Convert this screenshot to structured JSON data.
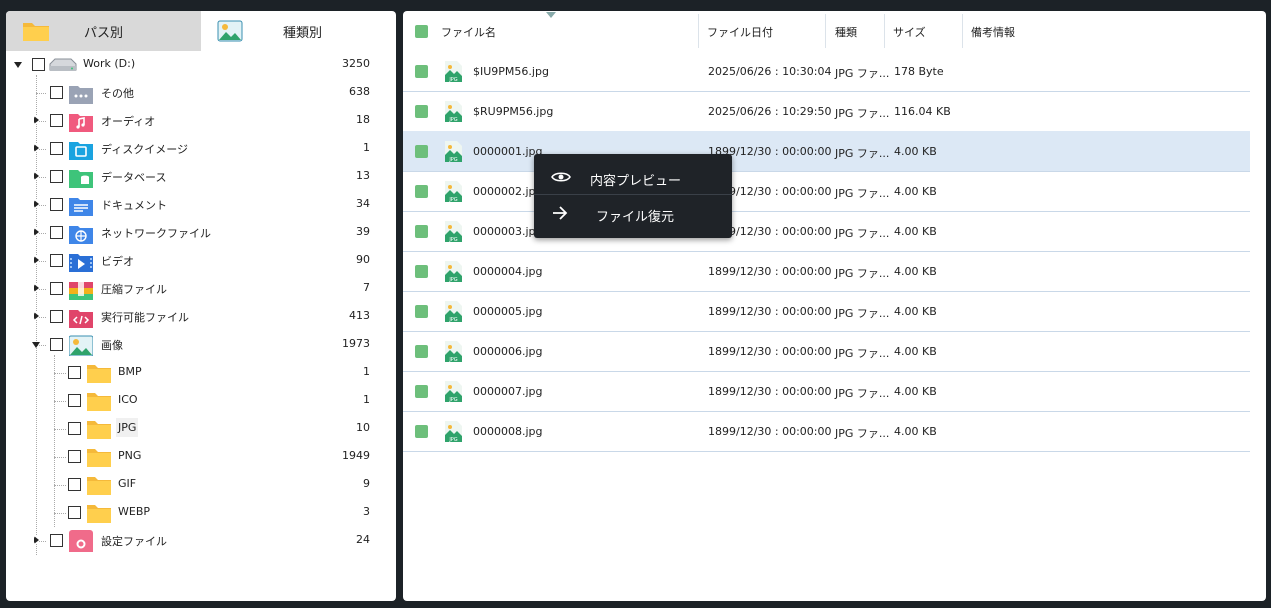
{
  "tabs": {
    "path_label": "パス別",
    "type_label": "種類別"
  },
  "tree": {
    "root": {
      "label": "Work (D:)",
      "count": "3250"
    },
    "items": [
      {
        "label": "その他",
        "count": "638",
        "icon": "other-icon",
        "color": "#9aa3b5"
      },
      {
        "label": "オーディオ",
        "count": "18",
        "icon": "audio-icon",
        "color": "#f05a7e"
      },
      {
        "label": "ディスクイメージ",
        "count": "1",
        "icon": "disk-image-icon",
        "color": "#1aa3e0"
      },
      {
        "label": "データベース",
        "count": "13",
        "icon": "database-icon",
        "color": "#3ec47a"
      },
      {
        "label": "ドキュメント",
        "count": "34",
        "icon": "document-icon",
        "color": "#3f86e8"
      },
      {
        "label": "ネットワークファイル",
        "count": "39",
        "icon": "network-icon",
        "color": "#3f86e8"
      },
      {
        "label": "ビデオ",
        "count": "90",
        "icon": "video-icon",
        "color": "#2a6fd6"
      },
      {
        "label": "圧縮ファイル",
        "count": "7",
        "icon": "archive-icon",
        "color": "#f2b21b"
      },
      {
        "label": "実行可能ファイル",
        "count": "413",
        "icon": "executable-icon",
        "color": "#e0456a"
      },
      {
        "label": "画像",
        "count": "1973",
        "icon": "image-icon",
        "color": "#3ab0a0"
      }
    ],
    "image_children": [
      {
        "label": "BMP",
        "count": "1"
      },
      {
        "label": "ICO",
        "count": "1"
      },
      {
        "label": "JPG",
        "count": "10"
      },
      {
        "label": "PNG",
        "count": "1949"
      },
      {
        "label": "GIF",
        "count": "9"
      },
      {
        "label": "WEBP",
        "count": "3"
      }
    ],
    "settings": {
      "label": "設定ファイル",
      "count": "24",
      "icon": "settings-file-icon",
      "color": "#f06b8a"
    }
  },
  "table": {
    "headers": {
      "name": "ファイル名",
      "date": "ファイル日付",
      "type": "種類",
      "size": "サイズ",
      "note": "備考情報"
    },
    "rows": [
      {
        "name": "$IU9PM56.jpg",
        "date": "2025/06/26 : 10:30:04",
        "type": "JPG ファ...",
        "size": "178 Byte"
      },
      {
        "name": "$RU9PM56.jpg",
        "date": "2025/06/26 : 10:29:50",
        "type": "JPG ファ...",
        "size": "116.04 KB"
      },
      {
        "name": "0000001.jpg",
        "date": "1899/12/30 : 00:00:00",
        "type": "JPG ファ...",
        "size": "4.00 KB"
      },
      {
        "name": "0000002.jpg",
        "date": "1899/12/30 : 00:00:00",
        "type": "JPG ファ...",
        "size": "4.00 KB"
      },
      {
        "name": "0000003.jpg",
        "date": "1899/12/30 : 00:00:00",
        "type": "JPG ファ...",
        "size": "4.00 KB"
      },
      {
        "name": "0000004.jpg",
        "date": "1899/12/30 : 00:00:00",
        "type": "JPG ファ...",
        "size": "4.00 KB"
      },
      {
        "name": "0000005.jpg",
        "date": "1899/12/30 : 00:00:00",
        "type": "JPG ファ...",
        "size": "4.00 KB"
      },
      {
        "name": "0000006.jpg",
        "date": "1899/12/30 : 00:00:00",
        "type": "JPG ファ...",
        "size": "4.00 KB"
      },
      {
        "name": "0000007.jpg",
        "date": "1899/12/30 : 00:00:00",
        "type": "JPG ファ...",
        "size": "4.00 KB"
      },
      {
        "name": "0000008.jpg",
        "date": "1899/12/30 : 00:00:00",
        "type": "JPG ファ...",
        "size": "4.00 KB"
      }
    ],
    "jpg_badge": "JPG"
  },
  "context_menu": {
    "preview_label": "内容プレビュー",
    "recover_label": "ファイル復元"
  }
}
